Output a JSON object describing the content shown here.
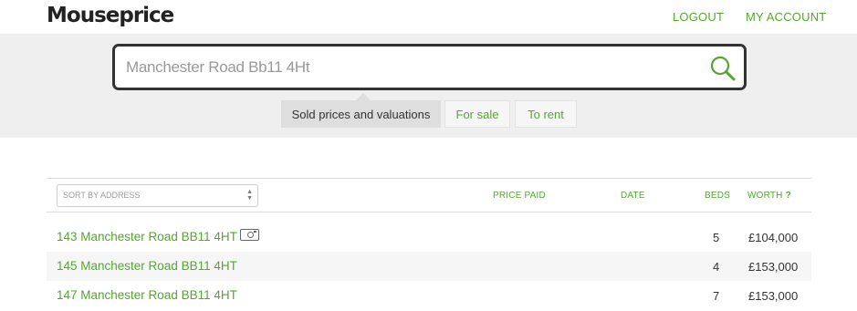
{
  "header": {
    "logo": "Mouseprice",
    "logout_label": "LOGOUT",
    "account_label": "MY ACCOUNT"
  },
  "search": {
    "value": "Manchester Road Bb11 4Ht",
    "icon": "search-icon"
  },
  "tabs": [
    {
      "label": "Sold prices and valuations",
      "active": true
    },
    {
      "label": "For sale",
      "active": false
    },
    {
      "label": "To rent",
      "active": false
    }
  ],
  "table": {
    "sort_label": "SORT BY ADDRESS",
    "columns": {
      "price_paid": "PRICE PAID",
      "date": "DATE",
      "beds": "BEDS",
      "worth": "WORTH",
      "worth_help": "?"
    },
    "rows": [
      {
        "address": "143 Manchester Road BB11 4HT",
        "has_photo": true,
        "price_paid": "",
        "date": "",
        "beds": "5",
        "worth": "£104,000"
      },
      {
        "address": "145 Manchester Road BB11 4HT",
        "has_photo": false,
        "price_paid": "",
        "date": "",
        "beds": "4",
        "worth": "£153,000"
      },
      {
        "address": "147 Manchester Road BB11 4HT",
        "has_photo": false,
        "price_paid": "",
        "date": "",
        "beds": "7",
        "worth": "£153,000"
      }
    ]
  },
  "colors": {
    "accent": "#55a630",
    "band": "#efefef",
    "active_tab": "#dedede"
  }
}
